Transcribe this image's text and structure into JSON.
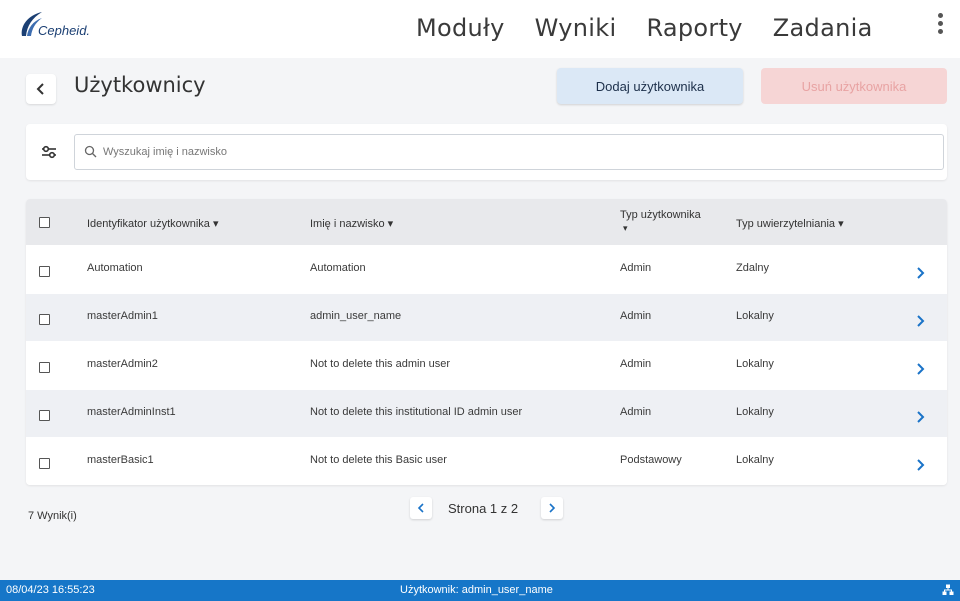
{
  "brand": {
    "logo_text": "Cepheid."
  },
  "nav": {
    "items": [
      {
        "label": "Moduły"
      },
      {
        "label": "Wyniki"
      },
      {
        "label": "Raporty"
      },
      {
        "label": "Zadania"
      }
    ]
  },
  "header": {
    "title": "Użytkownicy",
    "add_button": "Dodaj użytkownika",
    "delete_button": "Usuń użytkownika"
  },
  "search": {
    "placeholder": "Wyszukaj imię i nazwisko",
    "value": ""
  },
  "table": {
    "columns": [
      "Identyfikator użytkownika ▾",
      "Imię i nazwisko ▾",
      "Typ użytkownika",
      "▾",
      "Typ uwierzytelniania ▾"
    ],
    "rows": [
      {
        "id": "Automation",
        "name": "Automation",
        "type": "Admin",
        "auth": "Zdalny"
      },
      {
        "id": "masterAdmin1",
        "name": "admin_user_name",
        "type": "Admin",
        "auth": "Lokalny"
      },
      {
        "id": "masterAdmin2",
        "name": "Not to delete this admin user",
        "type": "Admin",
        "auth": "Lokalny"
      },
      {
        "id": "masterAdminInst1",
        "name": "Not to delete this institutional ID admin user",
        "type": "Admin",
        "auth": "Lokalny"
      },
      {
        "id": "masterBasic1",
        "name": "Not to delete this Basic user",
        "type": "Podstawowy",
        "auth": "Lokalny"
      }
    ]
  },
  "pagination": {
    "results": "7 Wynik(i)",
    "page_label": "Strona 1 z 2"
  },
  "status": {
    "datetime": "08/04/23 16:55:23",
    "user": "Użytkownik: admin_user_name"
  },
  "colors": {
    "accent": "#1676c8",
    "add_button_bg": "#dbe8f6",
    "delete_button_bg": "#f6d5d5",
    "chevron": "#1a73c8"
  }
}
